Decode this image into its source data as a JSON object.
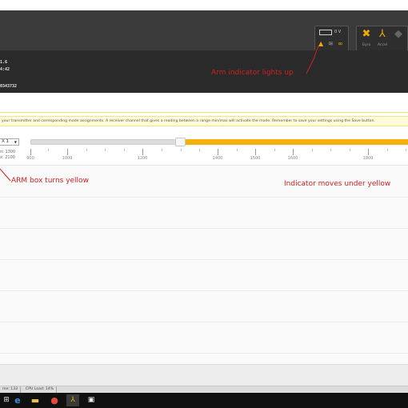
{
  "header": {
    "battery_voltage": "0 V",
    "sensors": [
      {
        "name": "gyro",
        "label": "Gyro",
        "active": true
      },
      {
        "name": "accel",
        "label": "Accel",
        "active": true
      },
      {
        "name": "mag",
        "label": "",
        "active": false
      }
    ],
    "info_lines": [
      "1.6",
      "4:42",
      "0343732"
    ]
  },
  "note": {
    "text": "your transmitter and corresponding mode assignments. A receiver channel that gives a reading between a range min/max will activate the mode. Remember to save your settings using the Save button."
  },
  "mode": {
    "channel_select": "X 1",
    "range_min_label": "n: 1300",
    "range_max_label": "x: 2100",
    "tick_labels": [
      "900",
      "1000",
      "1200",
      "1400",
      "1500",
      "1600",
      "1800"
    ],
    "range_fraction_min": 0.5,
    "range_fraction_max": 1.0
  },
  "status_bar": {
    "items": [
      "me: 133",
      "CPU Load: 14%"
    ]
  },
  "annotations": {
    "arm_indicator": "Arm indicator lights up",
    "arm_box": "ARM box turns yellow",
    "indicator_moves": "Indicator moves under yellow"
  },
  "colors": {
    "accent_yellow": "#f3b10e",
    "annotation_red": "#d02020",
    "header_dark": "#3b3b3b"
  }
}
